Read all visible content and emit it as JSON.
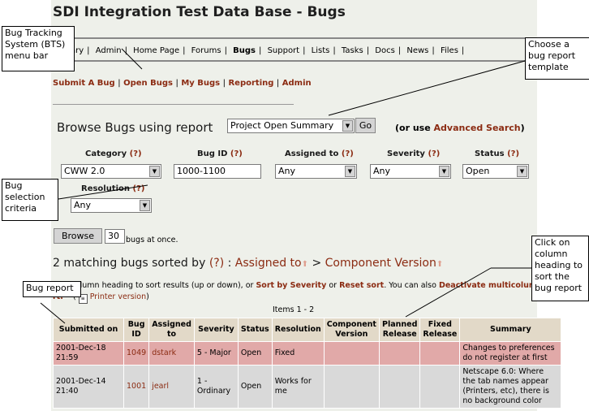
{
  "page": {
    "title": "SDI Integration Test Data Base - Bugs"
  },
  "menu": {
    "items": [
      "ary",
      "Admin",
      "Home Page",
      "Forums",
      "Bugs",
      "Support",
      "Lists",
      "Tasks",
      "Docs",
      "News",
      "Files"
    ],
    "separator": "|"
  },
  "submenu": {
    "items": [
      "Submit A Bug",
      "Open Bugs",
      "My Bugs",
      "Reporting",
      "Admin"
    ]
  },
  "browse": {
    "label": "Browse Bugs using report",
    "report_value": "Project Open Summary",
    "go_label": "Go",
    "or_use": "(or use",
    "advanced_link": "Advanced Search",
    "or_use_close": ")"
  },
  "criteria": {
    "category": {
      "label": "Category",
      "help": "(?)",
      "value": "CWW 2.0"
    },
    "bug_id": {
      "label": "Bug ID",
      "help": "(?)",
      "value": "1000-1100"
    },
    "assigned_to": {
      "label": "Assigned to",
      "help": "(?)",
      "value": "Any"
    },
    "severity": {
      "label": "Severity",
      "help": "(?)",
      "value": "Any"
    },
    "status": {
      "label": "Status",
      "help": "(?)",
      "value": "Open"
    },
    "resolution": {
      "label": "Resolution",
      "help": "(?)",
      "value": "Any"
    }
  },
  "browse_button": {
    "label": "Browse",
    "count_value": "30",
    "suffix": "bugs at once."
  },
  "results": {
    "heading_prefix": "2 matching bugs sorted by",
    "help": "(?)",
    "colon": ":",
    "sort1": "Assigned to",
    "gt": ">",
    "sort2": "Component Version",
    "info_pre": "ck a column heading to sort results (up or down), or",
    "sort_severity": "Sort by Severity",
    "or": "or",
    "reset_sort": "Reset sort",
    "info_mid": ". You can also",
    "deactivate": "Deactivate multicolumn",
    "rt": "rt.",
    "paren_open": "(",
    "printer": "Printer version",
    "paren_close": ")",
    "items_range": "Items 1 - 2"
  },
  "table": {
    "headers": [
      "Submitted on",
      "Bug ID",
      "Assigned to",
      "Severity",
      "Status",
      "Resolution",
      "Component Version",
      "Planned Release",
      "Fixed Release",
      "Summary"
    ],
    "rows": [
      {
        "submitted": "2001-Dec-18 21:59",
        "bug_id": "1049",
        "assigned": "dstark",
        "severity": "5 - Major",
        "status": "Open",
        "resolution": "Fixed",
        "component": "",
        "planned": "",
        "fixed": "",
        "summary": "Changes to preferences do not register at first"
      },
      {
        "submitted": "2001-Dec-14 21:40",
        "bug_id": "1001",
        "assigned": "jearl",
        "severity": "1 - Ordinary",
        "status": "Open",
        "resolution": "Works for me",
        "component": "",
        "planned": "",
        "fixed": "",
        "summary": "Netscape 6.0: Where the tab names appear (Printers, etc), there is no background color"
      }
    ]
  },
  "callouts": {
    "bts": "Bug Tracking System (BTS) menu bar",
    "template": "Choose a bug report template",
    "criteria": "Bug selection criteria",
    "click_col": "Click on column heading to sort the bug report",
    "bug_report": "Bug report"
  },
  "colors": {
    "link": "#8b2b12",
    "page_bg": "#eef0ea",
    "header_bg": "#e2d9c8",
    "major_row": "#e1a9a8",
    "ordinary_row": "#d9d9d9"
  }
}
